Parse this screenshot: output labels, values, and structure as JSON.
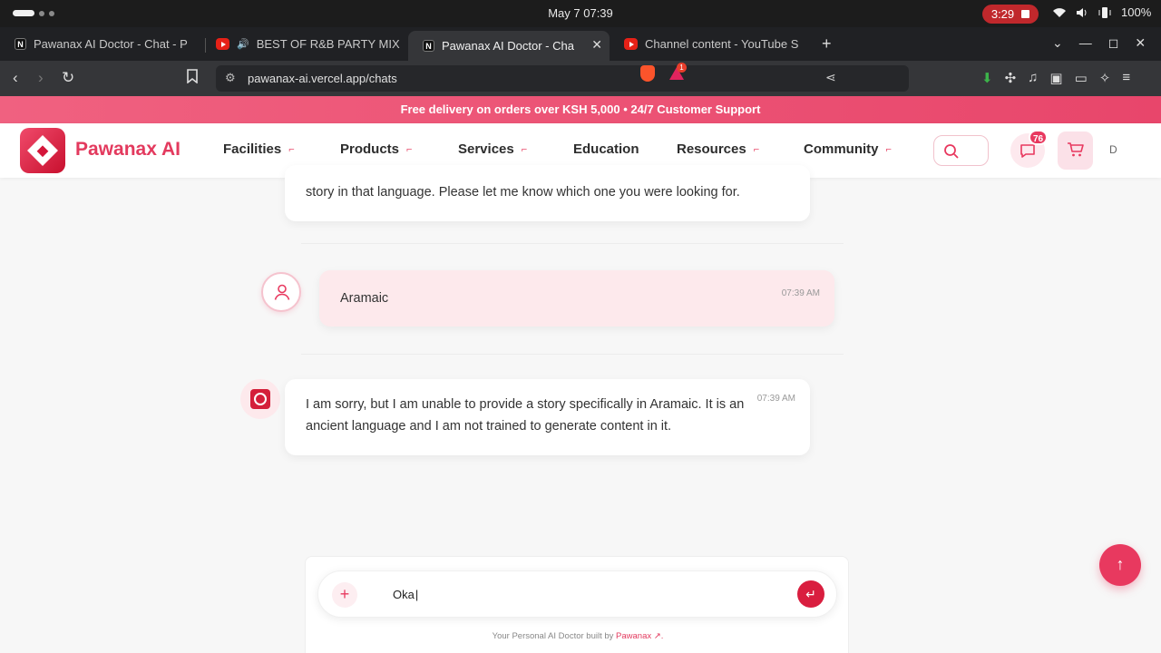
{
  "os": {
    "clock": "May 7  07:39",
    "recording_time": "3:29",
    "battery": "100%"
  },
  "tabs": [
    {
      "title": "Pawanax AI Doctor - Chat - P",
      "favicon": "n"
    },
    {
      "title": "BEST OF R&B PARTY MIX",
      "favicon": "yt",
      "audio": "🔊"
    },
    {
      "title": "Pawanax AI Doctor - Cha",
      "favicon": "n",
      "active": true
    },
    {
      "title": "Channel content - YouTube S",
      "favicon": "yt"
    }
  ],
  "tab_new": "+",
  "tab_close": "✕",
  "window_controls": {
    "chevron": "⌄",
    "minimize": "—",
    "maximize": "◻",
    "close": "✕"
  },
  "address_bar": {
    "url": "pawanax-ai.vercel.app/chats",
    "back": "‹",
    "forward": "›",
    "reload": "↻",
    "bookmark": "🔖",
    "bat_badge": "1"
  },
  "site": {
    "promo": "Free delivery on orders over KSH 5,000 • 24/7 Customer Support",
    "brand": "Pawanax AI",
    "nav": [
      {
        "label": "Facilities",
        "caret": "⌐"
      },
      {
        "label": "Products",
        "caret": "⌐"
      },
      {
        "label": "Services",
        "caret": "⌐"
      },
      {
        "label": "Education",
        "caret": ""
      },
      {
        "label": "Resources",
        "caret": "⌐"
      },
      {
        "label": "Community",
        "caret": "⌐"
      }
    ],
    "message_count": "76",
    "user_initial": "D",
    "accent": "#e8395f"
  },
  "chat": {
    "messages": [
      {
        "role": "bot",
        "text": "story in that language. Please let me know which one you were looking for."
      },
      {
        "role": "user",
        "text": "Aramaic",
        "time": "07:39 AM"
      },
      {
        "role": "bot",
        "text": "I am sorry, but I am unable to provide a story specifically in Aramaic. It is an ancient language and I am not trained to generate content in it.",
        "time": "07:39 AM"
      }
    ]
  },
  "composer": {
    "value": "Oka",
    "attach": "+",
    "send": "↵",
    "footnote_prefix": "Your Personal AI Doctor built by",
    "footnote_link": "Pawanax",
    "footnote_suffix": "↗."
  },
  "scroll_top": "↑"
}
